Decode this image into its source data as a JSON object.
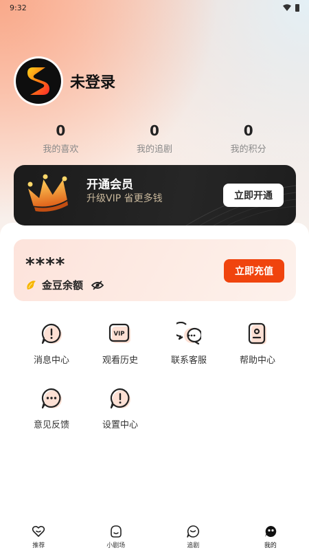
{
  "status_bar": {
    "time": "9:32"
  },
  "profile": {
    "username": "未登录"
  },
  "stats": [
    {
      "value": "0",
      "label": "我的喜欢"
    },
    {
      "value": "0",
      "label": "我的追剧"
    },
    {
      "value": "0",
      "label": "我的积分"
    }
  ],
  "vip": {
    "title": "开通会员",
    "subtitle": "升级VIP 省更多钱",
    "button_label": "立即开通"
  },
  "balance": {
    "value": "****",
    "label": "金豆余额",
    "button_label": "立即充值"
  },
  "menu": [
    {
      "label": "消息中心",
      "icon": "message-icon"
    },
    {
      "label": "观看历史",
      "icon": "vip-history-icon"
    },
    {
      "label": "联系客服",
      "icon": "chat-icon"
    },
    {
      "label": "帮助中心",
      "icon": "help-icon"
    },
    {
      "label": "意见反馈",
      "icon": "feedback-icon"
    },
    {
      "label": "设置中心",
      "icon": "settings-icon"
    }
  ],
  "tabbar": {
    "active_index": 3,
    "items": [
      {
        "label": "推荐",
        "icon": "heart-icon"
      },
      {
        "label": "小剧场",
        "icon": "smile-icon"
      },
      {
        "label": "追剧",
        "icon": "chase-icon"
      },
      {
        "label": "我的",
        "icon": "profile-icon"
      }
    ]
  },
  "colors": {
    "accent": "#f0440e",
    "vip_card": "#1b1b1b",
    "vip_subtitle": "#c8b79b"
  }
}
